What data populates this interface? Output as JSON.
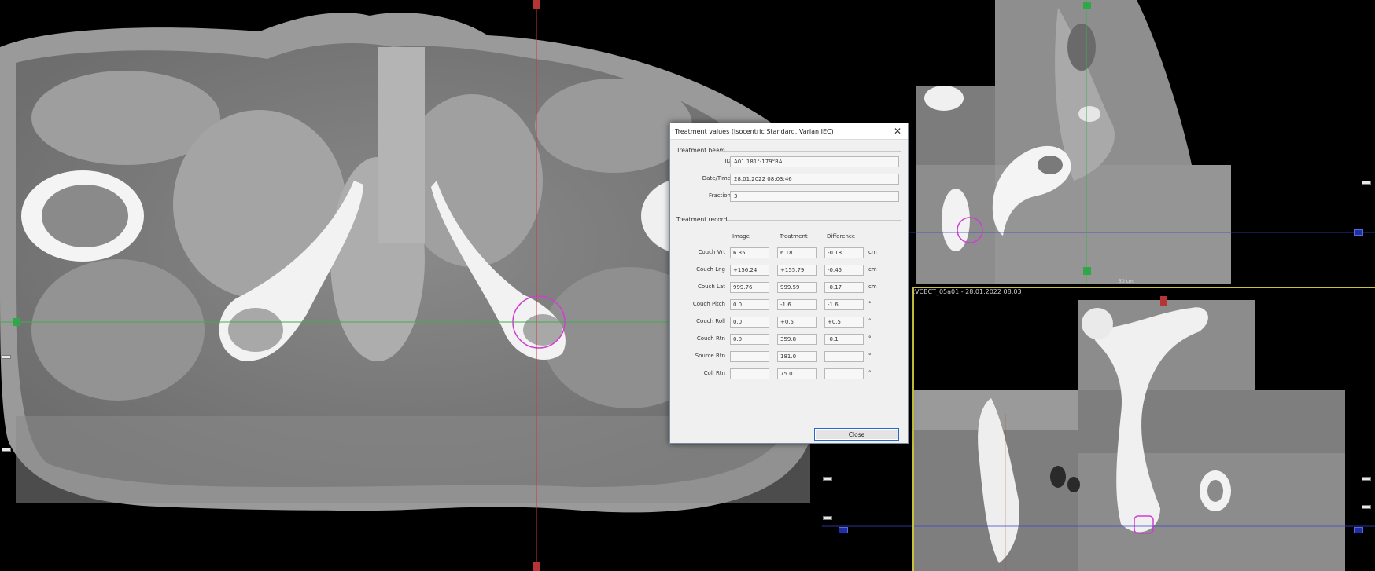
{
  "dialog": {
    "title": "Treatment values (Isocentric Standard, Varian IEC)",
    "close_icon": "close-icon",
    "treatment_beam": {
      "section_label": "Treatment beam",
      "fields": [
        {
          "label": "ID",
          "value": "A01 181°-179°RA"
        },
        {
          "label": "Date/Time",
          "value": "28.01.2022 08:03:46"
        },
        {
          "label": "Fraction",
          "value": "3"
        }
      ]
    },
    "treatment_record": {
      "section_label": "Treatment record",
      "columns": [
        "Image",
        "Treatment",
        "Difference"
      ],
      "rows": [
        {
          "label": "Couch Vrt",
          "image": "6.35",
          "treatment": "6.18",
          "difference": "-0.18",
          "unit": "cm"
        },
        {
          "label": "Couch Lng",
          "image": "+156.24",
          "treatment": "+155.79",
          "difference": "-0.45",
          "unit": "cm"
        },
        {
          "label": "Couch Lat",
          "image": "999.76",
          "treatment": "999.59",
          "difference": "-0.17",
          "unit": "cm"
        },
        {
          "label": "Couch Pitch",
          "image": "0.0",
          "treatment": "-1.6",
          "difference": "-1.6",
          "unit": "°"
        },
        {
          "label": "Couch Roll",
          "image": "0.0",
          "treatment": "+0.5",
          "difference": "+0.5",
          "unit": "°"
        },
        {
          "label": "Couch Rtn",
          "image": "0.0",
          "treatment": "359.8",
          "difference": "-0.1",
          "unit": "°"
        },
        {
          "label": "Source Rtn",
          "image": "",
          "treatment": "181.0",
          "difference": "",
          "unit": "°"
        },
        {
          "label": "Coll Rtn",
          "image": "",
          "treatment": "75.0",
          "difference": "",
          "unit": "°"
        }
      ]
    },
    "close_button_label": "Close"
  },
  "coronal_caption": "- kVCBCT_05a01 - 28.01.2022 08:03",
  "scale_label": "50 cm",
  "colors": {
    "crosshair_axial_vertical": "#c43a3a",
    "crosshair_axial_horizontal": "#3fae4a",
    "sagittal_crosshair_vertical": "#3fae4a",
    "sagittal_crosshair_horizontal": "#3a46c8",
    "target_contour": "#d23cd2",
    "viewport_border": "#c9c23c"
  }
}
